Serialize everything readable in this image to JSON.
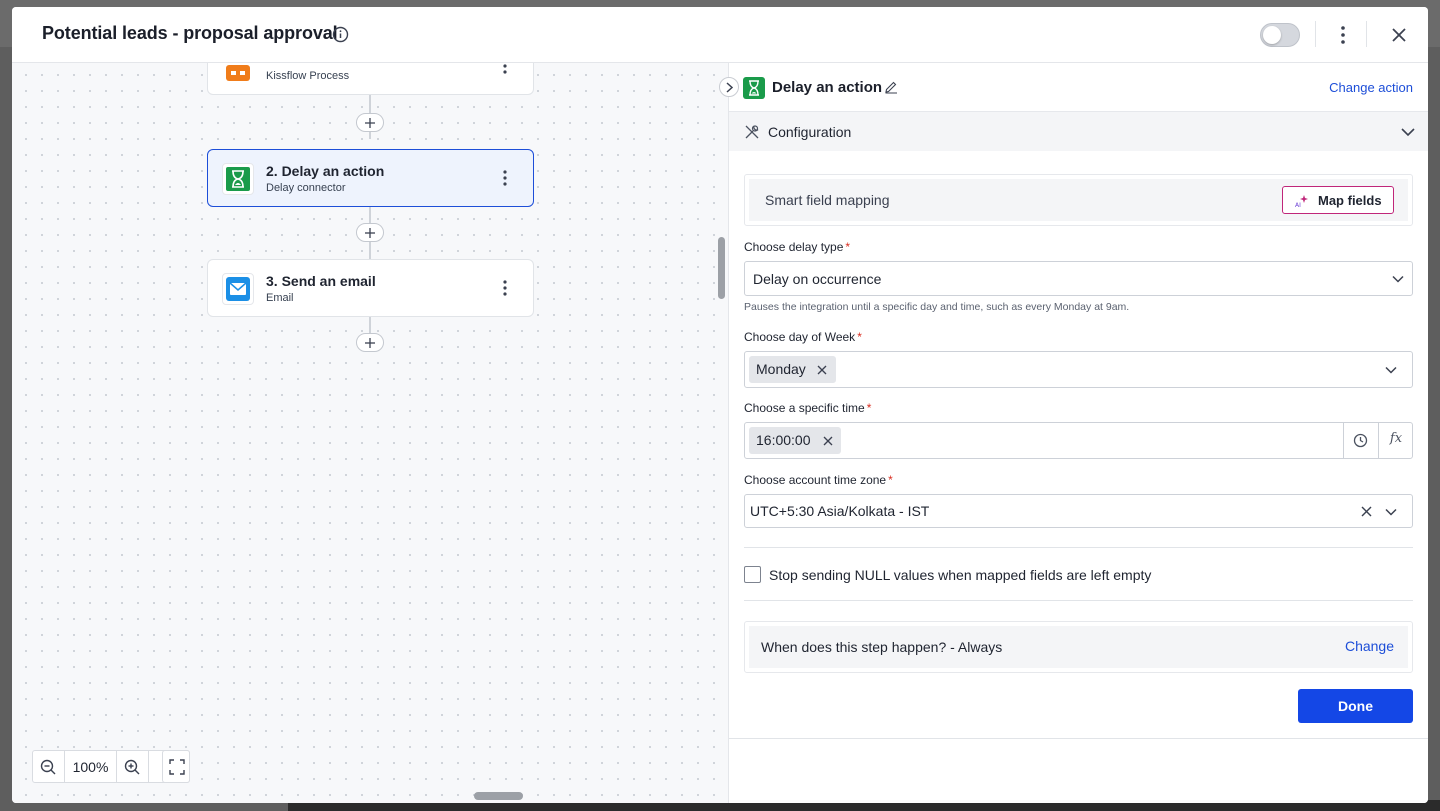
{
  "header": {
    "title": "Potential leads - proposal approval",
    "toggle_on": false
  },
  "canvas": {
    "nodes": [
      {
        "title": "",
        "subtitle": "Kissflow Process",
        "icon": "kissflow-icon",
        "color": "#f07c1a"
      },
      {
        "title": "2. Delay an action",
        "subtitle": "Delay connector",
        "icon": "hourglass-icon",
        "color": "#1a9b4a",
        "selected": true
      },
      {
        "title": "3. Send an email",
        "subtitle": "Email",
        "icon": "email-icon",
        "color": "#1b8fe6"
      }
    ],
    "zoom_level": "100%"
  },
  "panel": {
    "title": "Delay an action",
    "change_action": "Change action",
    "section": "Configuration",
    "smart_mapping": {
      "label": "Smart field mapping",
      "button": "Map fields"
    },
    "delay_type": {
      "label": "Choose delay type",
      "value": "Delay on occurrence",
      "help": "Pauses the integration until a specific day and time, such as every Monday at 9am."
    },
    "day_of_week": {
      "label": "Choose day of Week",
      "chips": [
        "Monday"
      ]
    },
    "specific_time": {
      "label": "Choose a specific time",
      "chips": [
        "16:00:00"
      ],
      "fx": "fx"
    },
    "time_zone": {
      "label": "Choose account time zone",
      "value": "UTC+5:30 Asia/Kolkata - IST"
    },
    "null_checkbox": {
      "label": "Stop sending NULL values when mapped fields are left empty",
      "checked": false
    },
    "condition": {
      "label": "When does this step happen? - Always",
      "change": "Change"
    },
    "done": "Done"
  },
  "colors": {
    "accent": "#1447e6",
    "link": "#1d4ed8",
    "required": "#d92d20",
    "map_border": "#c0267a"
  }
}
